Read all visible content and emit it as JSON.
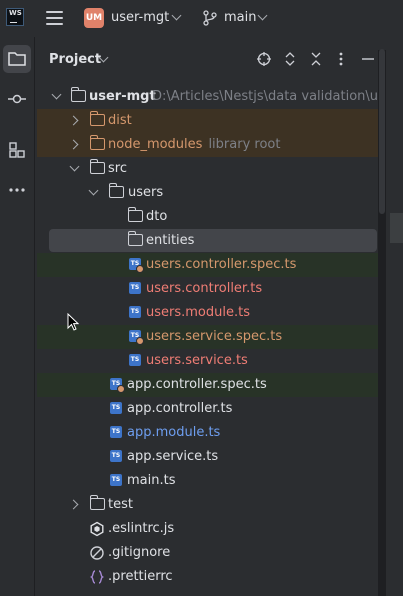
{
  "topbar": {
    "logo_text": "WS",
    "project_badge": "UM",
    "project_name": "user-mgt",
    "branch_name": "main"
  },
  "tool_window": {
    "title": "Project"
  },
  "tree": {
    "root": {
      "name": "user-mgt",
      "path": "D:\\Articles\\Nestjs\\data validation\\user"
    },
    "dist": {
      "name": "dist"
    },
    "node_modules": {
      "name": "node_modules",
      "hint": "library root"
    },
    "src": {
      "name": "src"
    },
    "users": {
      "name": "users"
    },
    "dto": {
      "name": "dto"
    },
    "entities": {
      "name": "entities"
    },
    "users_controller_spec": {
      "name": "users.controller.spec.ts"
    },
    "users_controller": {
      "name": "users.controller.ts"
    },
    "users_module": {
      "name": "users.module.ts"
    },
    "users_service_spec": {
      "name": "users.service.spec.ts"
    },
    "users_service": {
      "name": "users.service.ts"
    },
    "app_controller_spec": {
      "name": "app.controller.spec.ts"
    },
    "app_controller": {
      "name": "app.controller.ts"
    },
    "app_module": {
      "name": "app.module.ts"
    },
    "app_service": {
      "name": "app.service.ts"
    },
    "main": {
      "name": "main.ts"
    },
    "test": {
      "name": "test"
    },
    "eslintrc": {
      "name": ".eslintrc.js"
    },
    "gitignore": {
      "name": ".gitignore"
    },
    "prettierrc": {
      "name": ".prettierrc"
    }
  },
  "icons": {
    "file_ts": "TS"
  }
}
